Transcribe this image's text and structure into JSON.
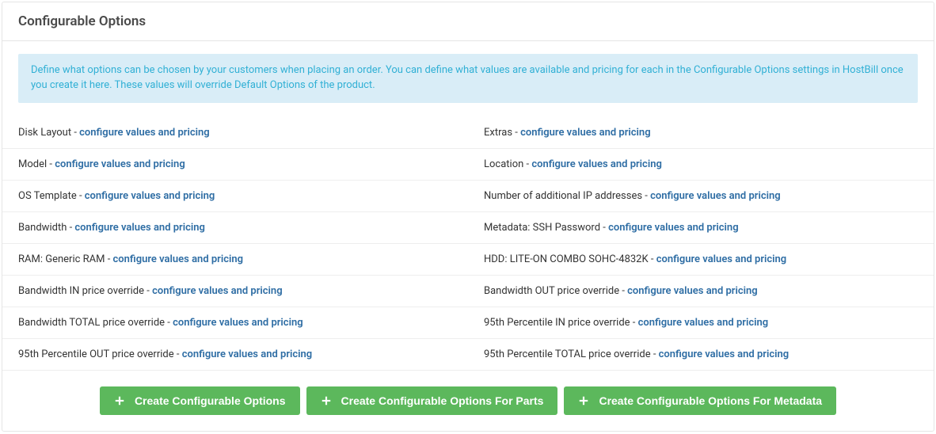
{
  "panel": {
    "title": "Configurable Options",
    "info": "Define what options can be chosen by your customers when placing an order. You can define what values are available and pricing for each in the Configurable Options settings in HostBill once you create it here. These values will override Default Options of the product."
  },
  "link_text": "configure values and pricing",
  "separator": " - ",
  "options": [
    {
      "label": "Disk Layout"
    },
    {
      "label": "Extras"
    },
    {
      "label": "Model"
    },
    {
      "label": "Location"
    },
    {
      "label": "OS Template"
    },
    {
      "label": "Number of additional IP addresses"
    },
    {
      "label": "Bandwidth"
    },
    {
      "label": "Metadata: SSH Password"
    },
    {
      "label": "RAM: Generic RAM"
    },
    {
      "label": "HDD: LITE-ON COMBO SOHC-4832K"
    },
    {
      "label": "Bandwidth IN price override"
    },
    {
      "label": "Bandwidth OUT price override"
    },
    {
      "label": "Bandwidth TOTAL price override"
    },
    {
      "label": "95th Percentile IN price override"
    },
    {
      "label": "95th Percentile OUT price override"
    },
    {
      "label": "95th Percentile TOTAL price override"
    }
  ],
  "buttons": {
    "create": "Create Configurable Options",
    "create_parts": "Create Configurable Options For Parts",
    "create_metadata": "Create Configurable Options For Metadata"
  }
}
